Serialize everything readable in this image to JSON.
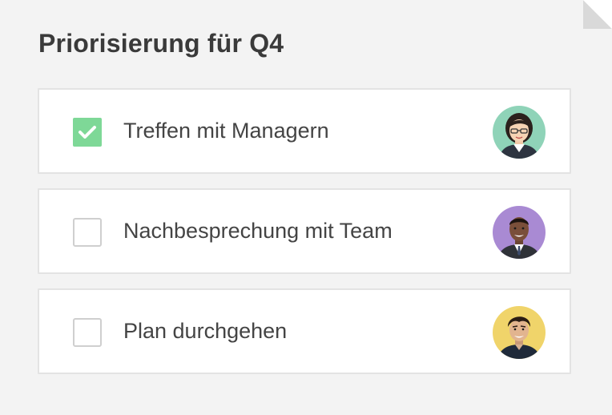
{
  "card": {
    "title": "Priorisierung für Q4"
  },
  "tasks": [
    {
      "label": "Treffen mit Managern",
      "checked": true,
      "avatar": "avatar-woman-glasses",
      "avatar_bg": "#8fd3b8"
    },
    {
      "label": "Nachbesprechung mit Team",
      "checked": false,
      "avatar": "avatar-man-purple",
      "avatar_bg": "#a98ad3"
    },
    {
      "label": "Plan durchgehen",
      "checked": false,
      "avatar": "avatar-man-yellow",
      "avatar_bg": "#f0d46a"
    }
  ],
  "colors": {
    "background": "#f3f3f3",
    "checked_fill": "#7ed897",
    "unchecked_border": "#cfcfcf",
    "row_border": "#e3e3e3",
    "title_text": "#3a3a3a",
    "task_text": "#444444"
  }
}
